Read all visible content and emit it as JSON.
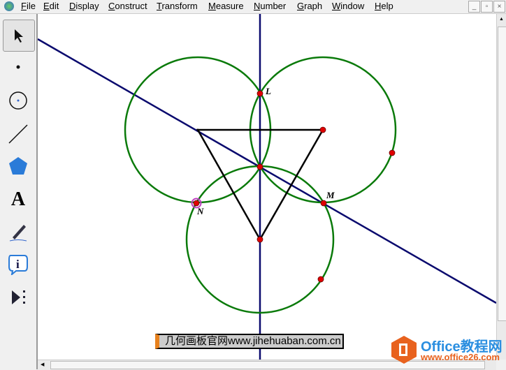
{
  "menu": [
    "File",
    "Edit",
    "Display",
    "Construct",
    "Transform",
    "Measure",
    "Number",
    "Graph",
    "Window",
    "Help"
  ],
  "window_buttons": [
    "_",
    "▫",
    "×"
  ],
  "tools": [
    "arrow-tool",
    "point-tool",
    "compass-tool",
    "straightedge-tool",
    "polygon-tool",
    "text-tool",
    "marker-tool",
    "information-tool",
    "custom-tool"
  ],
  "tool_text": "A",
  "labels": {
    "L": "L",
    "M": "M",
    "N": "N"
  },
  "caption": "几何画板官网www.jihehuaban.com.cn",
  "watermark": {
    "title": "Office教程网",
    "url": "www.office26.com"
  },
  "colors": {
    "circle": "#0a7a0a",
    "line": "#0a0a6e",
    "point": "#e00000",
    "triangle": "#000000"
  }
}
